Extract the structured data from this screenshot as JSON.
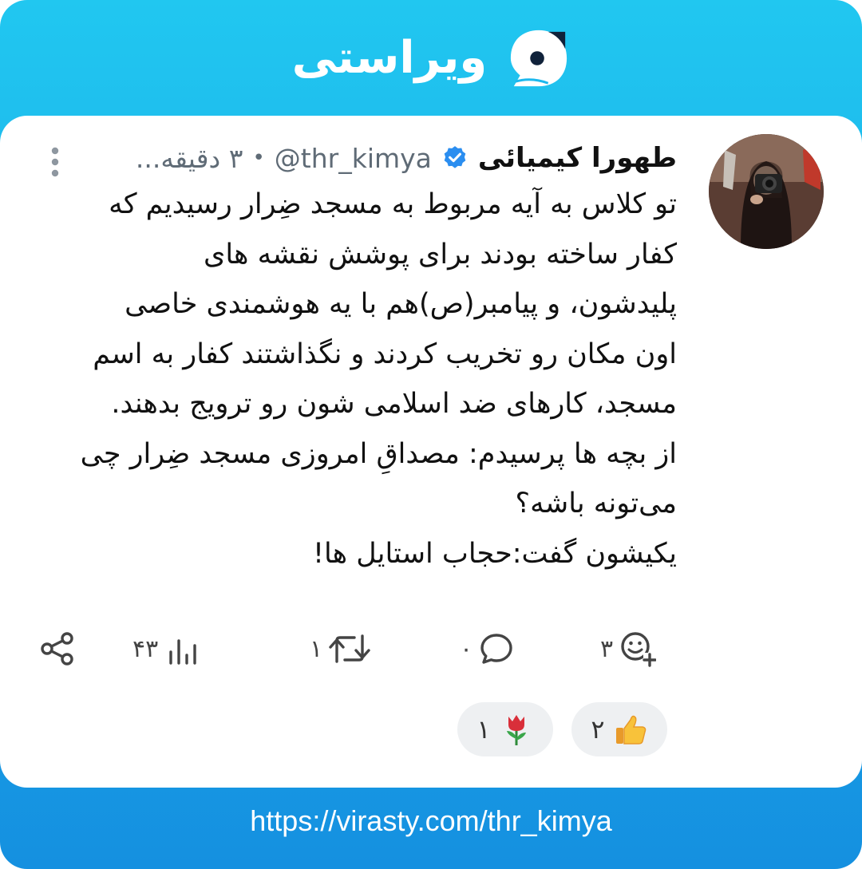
{
  "brand": {
    "name": "ویراستی"
  },
  "post": {
    "author_name": "طهورا کیمیائی",
    "handle": "@thr_kimya",
    "separator": "•",
    "time": "۳ دقیقه...",
    "verified": true,
    "body_lines": [
      "تو کلاس به آیه مربوط به مسجد ضِرار رسیدیم که",
      "کفار ساخته بودند برای پوشش نقشه های",
      "پلیدشون، و پیامبر(ص)هم با یه هوشمندی خاصی",
      "اون مکان رو تخریب کردند و نگذاشتند کفار به اسم",
      "مسجد، کارهای ضد اسلامی شون رو ترویج بدهند.",
      "از بچه ها پرسیدم: مصداقِ امروزی مسجد ضِرار چی",
      "می‌تونه باشه؟",
      "یکیشون گفت:حجاب استایل ها!"
    ]
  },
  "actions": {
    "reactions_count": "۳",
    "comments_count": "۰",
    "reposts_count": "۱",
    "views_count": "۴۳"
  },
  "reactions": [
    {
      "emoji": "👍",
      "icon": "thumbs-up-icon",
      "count": "۲"
    },
    {
      "emoji": "🌷",
      "icon": "tulip-icon",
      "count": "۱"
    }
  ],
  "footer": {
    "url": "https://virasty.com/thr_kimya"
  },
  "colors": {
    "accent": "#1cb8ee",
    "verified": "#2b8ef0"
  }
}
